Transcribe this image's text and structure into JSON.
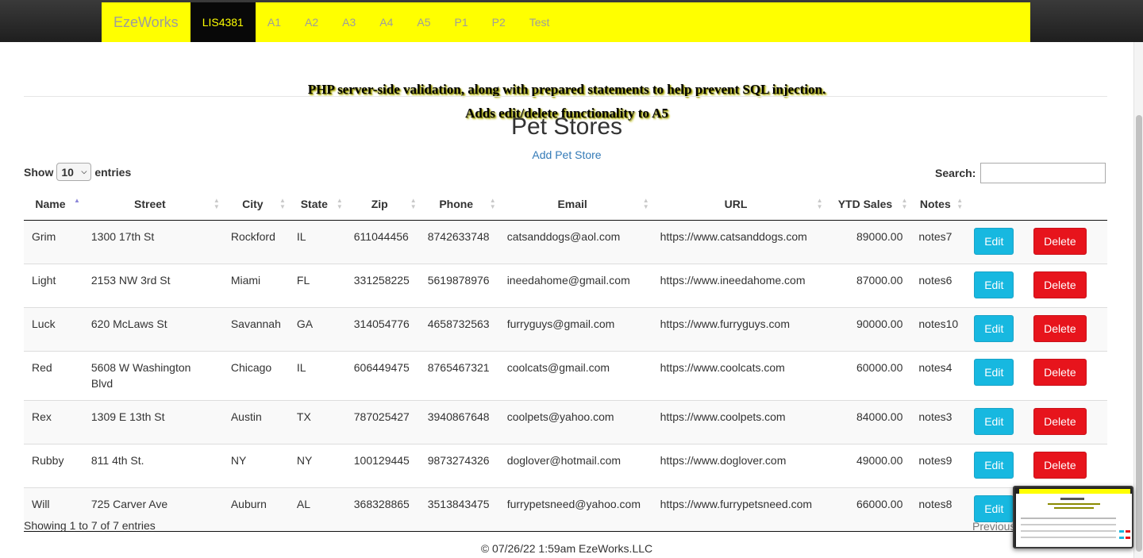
{
  "navbar": {
    "brand": "EzeWorks",
    "items": [
      "LIS4381",
      "A1",
      "A2",
      "A3",
      "A4",
      "A5",
      "P1",
      "P2",
      "Test"
    ],
    "active": "LIS4381"
  },
  "header": {
    "line1": "PHP server-side validation, along with prepared statements to help prevent SQL injection.",
    "line2": "Adds edit/delete functionality to A5"
  },
  "main": {
    "title": "Pet Stores",
    "add_link": "Add Pet Store",
    "length": {
      "show": "Show",
      "value": "10",
      "entries": "entries"
    },
    "search": {
      "label": "Search:",
      "value": ""
    },
    "columns": [
      "Name",
      "Street",
      "City",
      "State",
      "Zip",
      "Phone",
      "Email",
      "URL",
      "YTD Sales",
      "Notes"
    ],
    "sorted_column": "Name",
    "rows": [
      {
        "name": "Grim",
        "street": "1300 17th St",
        "city": "Rockford",
        "state": "IL",
        "zip": "611044456",
        "phone": "8742633748",
        "email": "catsanddogs@aol.com",
        "url": "https://www.catsanddogs.com",
        "ytd": "89000.00",
        "notes": "notes7"
      },
      {
        "name": "Light",
        "street": "2153 NW 3rd St",
        "city": "Miami",
        "state": "FL",
        "zip": "331258225",
        "phone": "5619878976",
        "email": "ineedahome@gmail.com",
        "url": "https://www.ineedahome.com",
        "ytd": "87000.00",
        "notes": "notes6"
      },
      {
        "name": "Luck",
        "street": "620 McLaws St",
        "city": "Savannah",
        "state": "GA",
        "zip": "314054776",
        "phone": "4658732563",
        "email": "furryguys@gmail.com",
        "url": "https://www.furryguys.com",
        "ytd": "90000.00",
        "notes": "notes10"
      },
      {
        "name": "Red",
        "street": "5608 W Washington Blvd",
        "city": "Chicago",
        "state": "IL",
        "zip": "606449475",
        "phone": "8765467321",
        "email": "coolcats@gmail.com",
        "url": "https://www.coolcats.com",
        "ytd": "60000.00",
        "notes": "notes4"
      },
      {
        "name": "Rex",
        "street": "1309 E 13th St",
        "city": "Austin",
        "state": "TX",
        "zip": "787025427",
        "phone": "3940867648",
        "email": "coolpets@yahoo.com",
        "url": "https://www.coolpets.com",
        "ytd": "84000.00",
        "notes": "notes3"
      },
      {
        "name": "Rubby",
        "street": "811 4th St.",
        "city": "NY",
        "state": "NY",
        "zip": "100129445",
        "phone": "9873274326",
        "email": "doglover@hotmail.com",
        "url": "https://www.doglover.com",
        "ytd": "49000.00",
        "notes": "notes9"
      },
      {
        "name": "Will",
        "street": "725 Carver Ave",
        "city": "Auburn",
        "state": "AL",
        "zip": "368328865",
        "phone": "3513843475",
        "email": "furrypetsneed@yahoo.com",
        "url": "https://www.furrypetsneed.com",
        "ytd": "66000.00",
        "notes": "notes8"
      }
    ],
    "edit_label": "Edit",
    "delete_label": "Delete",
    "info": "Showing 1 to 7 of 7 entries",
    "previous": "Previous"
  },
  "footer": {
    "text": "© 07/26/22 1:59am EzeWorks.LLC"
  },
  "colors": {
    "navbar": "#ffff00",
    "active_tab": "#080808",
    "edit": "#17b8e0",
    "delete": "#e7141c",
    "link": "#337ab7"
  }
}
